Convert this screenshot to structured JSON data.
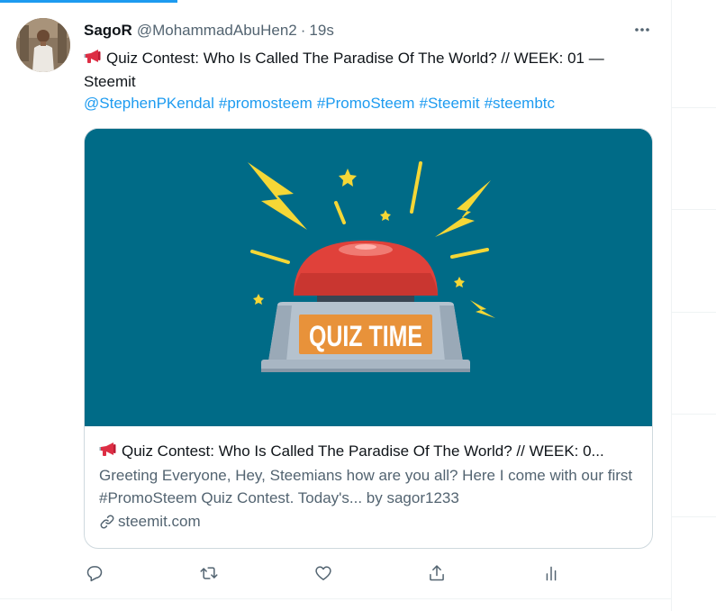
{
  "tweet": {
    "author_name": "SagoR",
    "handle": "@MohammadAbuHen2",
    "separator": "·",
    "time": "19s",
    "text": "Quiz Contest: Who Is Called The Paradise Of The World? // WEEK: 01 — Steemit",
    "hashtags": [
      "@StephenPKendal",
      "#promosteem",
      "#PromoSteem",
      "#Steemit",
      "#steembtc"
    ]
  },
  "card": {
    "image_text": "QUIZ TIME",
    "title": "Quiz Contest: Who Is Called The Paradise Of The World? // WEEK: 0...",
    "description": "Greeting Everyone, Hey, Steemians how are you all? Here I come with our first #PromoSteem Quiz Contest. Today's... by sagor1233",
    "domain": "steemit.com"
  },
  "actions": [
    "reply-icon",
    "retweet-icon",
    "like-icon",
    "share-icon",
    "analytics-icon"
  ],
  "colors": {
    "accent": "#1d9bf0",
    "text": "#0f1419",
    "secondary": "#536471",
    "card_bg": "#006b87",
    "button_red": "#e0413a",
    "label_orange": "#e8923a",
    "spark_yellow": "#f5d736"
  }
}
